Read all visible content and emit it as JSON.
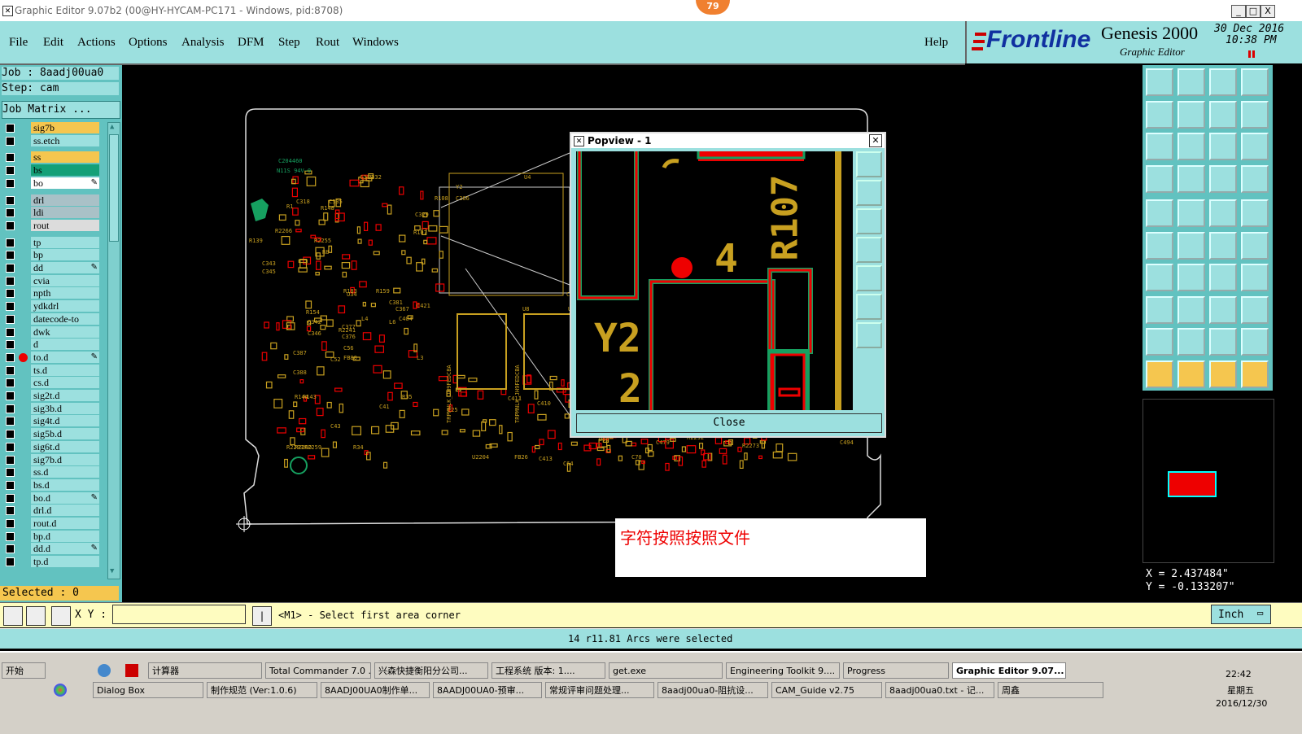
{
  "window": {
    "title": "Graphic Editor 9.07b2 (00@HY-HYCAM-PC171 - Windows, pid:8708)",
    "badge": "79",
    "controls": [
      "_",
      "□",
      "X"
    ]
  },
  "menubar": {
    "items": [
      "File",
      "Edit",
      "Actions",
      "Options",
      "Analysis",
      "DFM",
      "Step",
      "Rout",
      "Windows"
    ],
    "help": "Help"
  },
  "brand": {
    "logo": "Frontline",
    "product": "Genesis 2000",
    "subtitle": "Graphic Editor",
    "date": "30 Dec 2016",
    "time": "10:38 PM"
  },
  "left_panel": {
    "job": "Job : 8aadj00ua0",
    "step": "Step: cam",
    "job_matrix": "Job Matrix ...",
    "layers": [
      {
        "name": "sig7b",
        "color": "#f5c64f",
        "group": 0
      },
      {
        "name": "ss.etch",
        "color": "#9ce0df",
        "group": 0
      },
      {
        "name": "ss",
        "color": "#f5c64f",
        "group": 1
      },
      {
        "name": "bs",
        "color": "#14a078",
        "group": 1
      },
      {
        "name": "bo",
        "color": "#ffffff",
        "group": 1,
        "editable": true
      },
      {
        "name": "drl",
        "color": "#a9c1c7",
        "group": 2
      },
      {
        "name": "ldi",
        "color": "#a9c1c7",
        "group": 2
      },
      {
        "name": "rout",
        "color": "#dcdcdc",
        "group": 2
      },
      {
        "name": "tp",
        "color": "#9ce0df",
        "group": 3
      },
      {
        "name": "bp",
        "color": "#9ce0df",
        "group": 3
      },
      {
        "name": "dd",
        "color": "#9ce0df",
        "group": 3,
        "editable": true
      },
      {
        "name": "cvia",
        "color": "#9ce0df",
        "group": 3
      },
      {
        "name": "npth",
        "color": "#9ce0df",
        "group": 3
      },
      {
        "name": "ydkdrl",
        "color": "#9ce0df",
        "group": 3
      },
      {
        "name": "datecode-to",
        "color": "#9ce0df",
        "group": 3
      },
      {
        "name": "dwk",
        "color": "#9ce0df",
        "group": 3
      },
      {
        "name": "d",
        "color": "#9ce0df",
        "group": 3
      },
      {
        "name": "to.d",
        "color": "#9ce0df",
        "group": 3,
        "active": true,
        "editable": true
      },
      {
        "name": "ts.d",
        "color": "#9ce0df",
        "group": 3
      },
      {
        "name": "cs.d",
        "color": "#9ce0df",
        "group": 3
      },
      {
        "name": "sig2t.d",
        "color": "#9ce0df",
        "group": 3
      },
      {
        "name": "sig3b.d",
        "color": "#9ce0df",
        "group": 3
      },
      {
        "name": "sig4t.d",
        "color": "#9ce0df",
        "group": 3
      },
      {
        "name": "sig5b.d",
        "color": "#9ce0df",
        "group": 3
      },
      {
        "name": "sig6t.d",
        "color": "#9ce0df",
        "group": 3
      },
      {
        "name": "sig7b.d",
        "color": "#9ce0df",
        "group": 3
      },
      {
        "name": "ss.d",
        "color": "#9ce0df",
        "group": 3
      },
      {
        "name": "bs.d",
        "color": "#9ce0df",
        "group": 3
      },
      {
        "name": "bo.d",
        "color": "#9ce0df",
        "group": 3,
        "editable": true
      },
      {
        "name": "drl.d",
        "color": "#9ce0df",
        "group": 3
      },
      {
        "name": "rout.d",
        "color": "#9ce0df",
        "group": 3
      },
      {
        "name": "bp.d",
        "color": "#9ce0df",
        "group": 3
      },
      {
        "name": "dd.d",
        "color": "#9ce0df",
        "group": 3,
        "editable": true
      },
      {
        "name": "tp.d",
        "color": "#9ce0df",
        "group": 3
      }
    ],
    "selected": "Selected : 0"
  },
  "board_labels": [
    "C204460",
    "N11S 94V-0",
    "R139",
    "U4",
    "C379",
    "U7",
    "U8",
    "R2292",
    "C494",
    "R2273",
    "U36",
    "C479",
    "C70",
    "U2204",
    "FB26",
    "C64",
    "C413",
    "C411",
    "C410",
    "L4",
    "L6",
    "L3",
    "C52",
    "C43",
    "R34",
    "R35",
    "R144",
    "R143",
    "C387",
    "C388",
    "R154",
    "C342",
    "C346",
    "C343",
    "C345",
    "R183",
    "R159",
    "R2266",
    "R2255",
    "R8",
    "R1",
    "C318",
    "R148",
    "C335",
    "C319",
    "C332",
    "U34",
    "C381",
    "C329",
    "R107",
    "R108",
    "Y2",
    "C366",
    "C367",
    "C404",
    "C421",
    "R2241",
    "C56",
    "C41",
    "C25",
    "FB80",
    "C377",
    "C376",
    "R2293",
    "R2260",
    "R2259",
    "TRPMNLK_JH9FEDCBA",
    "TRPMNLK_JH9FEDCBA"
  ],
  "popview": {
    "title": "Popview - 1",
    "close": "Close",
    "labels": [
      "R107",
      "4",
      "Y2",
      "2"
    ]
  },
  "note": "字符按照按照文件",
  "coords": {
    "x": "X = 2.437484\"",
    "y": "Y = -0.133207\""
  },
  "cmd": {
    "xy_label": "X Y :",
    "prompt": "<M1> - Select first area corner",
    "units": "Inch"
  },
  "status": "14 r11.81 Arcs were selected",
  "taskbar": {
    "start": "开始",
    "row1": [
      "计算器",
      "Total Commander 7.0 ...",
      "兴森快捷衡阳分公司...",
      "工程系统  版本: 1....",
      "get.exe",
      "Engineering Toolkit 9....",
      "Progress",
      "Graphic Editor 9.07..."
    ],
    "row2": [
      "Dialog Box",
      "制作规范 (Ver:1.0.6)",
      "8AADJ00UA0制作单...",
      "8AADJ00UA0-预审...",
      "常规评审问题处理...",
      "8aadj00ua0-阻抗设...",
      "CAM_Guide v2.75",
      "8aadj00ua0.txt - 记...",
      "周鑫"
    ],
    "clock_time": "22:42",
    "clock_day": "星期五",
    "clock_date": "2016/12/30"
  },
  "icons": [
    "app-icon",
    "shield-icon",
    "folder-icon",
    "pointer-icon",
    "zoom-icon",
    "snap-icon",
    "measure-icon"
  ]
}
